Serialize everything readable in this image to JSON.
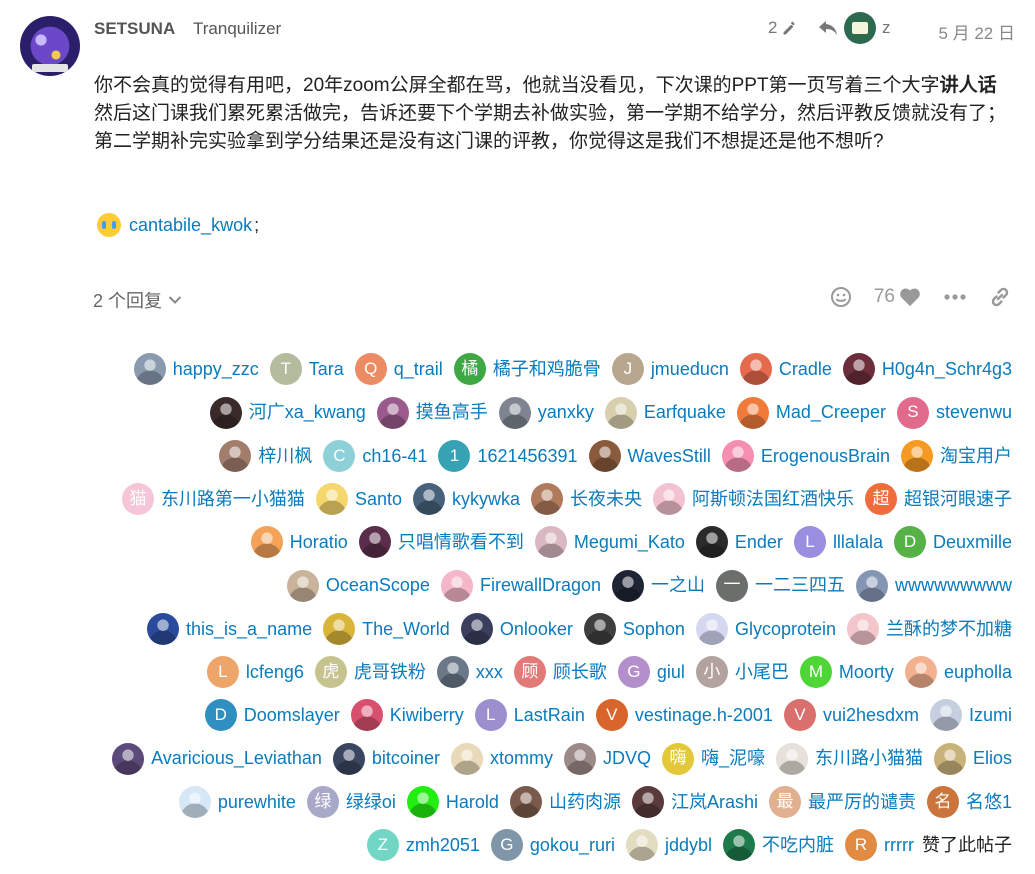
{
  "post": {
    "username": "SETSUNA",
    "full_name": "Tranquilizer",
    "edit_count": "2",
    "reply_to": "z",
    "date": "5 月 22 日",
    "body_p1_normal": "你不会真的觉得有用吧，20年zoom公屏全都在骂，他就当没看见，下次课的PPT第一页写着三个大字",
    "body_p1_bold": "讲人话",
    "body_p2": "然后这门课我们累死累活做完，告诉还要下个学期去补做实验，第一学期不给学分，然后评教反馈就没有了；第二学期补完实验拿到学分结果还是没有这门课的评教，你觉得这是我们不想提还是他不想听?",
    "mention": "cantabile_kwok",
    "mention_suffix": ";",
    "replies_label": "2 个回复",
    "like_count": "76",
    "likers_suffix": "赞了此帖子"
  },
  "likers": [
    {
      "name": "happy_zzc",
      "letter": "",
      "color": "#8a9bb0"
    },
    {
      "name": "Tara",
      "letter": "T",
      "color": "#b3bc9d"
    },
    {
      "name": "q_trail",
      "letter": "Q",
      "color": "#ec8c64"
    },
    {
      "name": "橘子和鸡脆骨",
      "letter": "橘",
      "color": "#3ea845"
    },
    {
      "name": "jmueducn",
      "letter": "J",
      "color": "#b8a78f"
    },
    {
      "name": "Cradle",
      "letter": "",
      "color": "#e56a4e"
    },
    {
      "name": "H0g4n_Schr4g3",
      "letter": "",
      "color": "#6b2e3a"
    },
    {
      "name": "河广xa_kwang",
      "letter": "",
      "color": "#3b2a2a"
    },
    {
      "name": "摸鱼高手",
      "letter": "",
      "color": "#9a5a8c"
    },
    {
      "name": "yanxky",
      "letter": "",
      "color": "#7e8590"
    },
    {
      "name": "Earfquake",
      "letter": "",
      "color": "#d8cfae"
    },
    {
      "name": "Mad_Creeper",
      "letter": "",
      "color": "#f07a3a"
    },
    {
      "name": "stevenwu",
      "letter": "S",
      "color": "#e26a8c"
    },
    {
      "name": "梓川枫",
      "letter": "",
      "color": "#a27d6c"
    },
    {
      "name": "ch16-41",
      "letter": "C",
      "color": "#8ed0d8"
    },
    {
      "name": "1621456391",
      "letter": "1",
      "color": "#38a2b5"
    },
    {
      "name": "WavesStill",
      "letter": "",
      "color": "#8a5a3c"
    },
    {
      "name": "ErogenousBrain",
      "letter": "",
      "color": "#f48fb1"
    },
    {
      "name": "淘宝用户",
      "letter": "",
      "color": "#f59a22"
    },
    {
      "name": "东川路第一小猫猫",
      "letter": "猫",
      "color": "#f6c6d8"
    },
    {
      "name": "Santo",
      "letter": "",
      "color": "#f5d76e"
    },
    {
      "name": "kykywka",
      "letter": "",
      "color": "#47617a"
    },
    {
      "name": "长夜未央",
      "letter": "",
      "color": "#b07a5c"
    },
    {
      "name": "阿斯顿法国红酒快乐",
      "letter": "",
      "color": "#f3c2d0"
    },
    {
      "name": "超银河眼速子",
      "letter": "超",
      "color": "#ef6d3d"
    },
    {
      "name": "Horatio",
      "letter": "",
      "color": "#f4a25a"
    },
    {
      "name": "只唱情歌看不到",
      "letter": "",
      "color": "#5a2d4a"
    },
    {
      "name": "Megumi_Kato",
      "letter": "",
      "color": "#d9b8c2"
    },
    {
      "name": "Ender",
      "letter": "",
      "color": "#2b2b2b"
    },
    {
      "name": "lllalala",
      "letter": "L",
      "color": "#9a8ee0"
    },
    {
      "name": "Deuxmille",
      "letter": "D",
      "color": "#56b146"
    },
    {
      "name": "OceanScope",
      "letter": "",
      "color": "#c9b39a"
    },
    {
      "name": "FirewallDragon",
      "letter": "",
      "color": "#f4b6c8"
    },
    {
      "name": "一之山",
      "letter": "",
      "color": "#1e2433"
    },
    {
      "name": "一二三四五",
      "letter": "一",
      "color": "#6b6f6b"
    },
    {
      "name": "wwwwwwwww",
      "letter": "",
      "color": "#8596b5"
    },
    {
      "name": "this_is_a_name",
      "letter": "",
      "color": "#2a4b9b"
    },
    {
      "name": "The_World",
      "letter": "",
      "color": "#d9b53a"
    },
    {
      "name": "Onlooker",
      "letter": "",
      "color": "#3a3f5e"
    },
    {
      "name": "Sophon",
      "letter": "",
      "color": "#3f3f3f"
    },
    {
      "name": "Glycoprotein",
      "letter": "",
      "color": "#d6d8f2"
    },
    {
      "name": "兰酥的梦不加糖",
      "letter": "",
      "color": "#f3c6cc"
    },
    {
      "name": "lcfeng6",
      "letter": "L",
      "color": "#eea56a"
    },
    {
      "name": "虎哥铁粉",
      "letter": "虎",
      "color": "#c6c38e"
    },
    {
      "name": "xxx",
      "letter": "",
      "color": "#6a7888"
    },
    {
      "name": "顾长歌",
      "letter": "顾",
      "color": "#e27a78"
    },
    {
      "name": "giul",
      "letter": "G",
      "color": "#b38fcc"
    },
    {
      "name": "小尾巴",
      "letter": "小",
      "color": "#b4a29f"
    },
    {
      "name": "Moorty",
      "letter": "M",
      "color": "#4dd636"
    },
    {
      "name": "eupholla",
      "letter": "",
      "color": "#f2b08f"
    },
    {
      "name": "Doomslayer",
      "letter": "D",
      "color": "#2f8fc0"
    },
    {
      "name": "Kiwiberry",
      "letter": "",
      "color": "#d8506e"
    },
    {
      "name": "LastRain",
      "letter": "L",
      "color": "#9c8fce"
    },
    {
      "name": "vestinage.h-2001",
      "letter": "V",
      "color": "#d9652c"
    },
    {
      "name": "vui2hesdxm",
      "letter": "V",
      "color": "#d9706e"
    },
    {
      "name": "Izumi",
      "letter": "",
      "color": "#c5cfe0"
    },
    {
      "name": "Avaricious_Leviathan",
      "letter": "",
      "color": "#5c4a7a"
    },
    {
      "name": "bitcoiner",
      "letter": "",
      "color": "#3a4560"
    },
    {
      "name": "xtommy",
      "letter": "",
      "color": "#e9d9b8"
    },
    {
      "name": "JDVQ",
      "letter": "",
      "color": "#9c8a88"
    },
    {
      "name": "嗨_泥嚎",
      "letter": "嗨",
      "color": "#e3c93a"
    },
    {
      "name": "东川路小猫猫",
      "letter": "",
      "color": "#e8e0da"
    },
    {
      "name": "Elios",
      "letter": "",
      "color": "#c9b27a"
    },
    {
      "name": "purewhite",
      "letter": "",
      "color": "#d6e8f8"
    },
    {
      "name": "绿绿oi",
      "letter": "绿",
      "color": "#a8a8c8"
    },
    {
      "name": "Harold",
      "letter": "",
      "color": "#22ee11"
    },
    {
      "name": "山药肉源",
      "letter": "",
      "color": "#7a5a4a"
    },
    {
      "name": "江岚Arashi",
      "letter": "",
      "color": "#5a3a3a"
    },
    {
      "name": "最严厉的谴责",
      "letter": "最",
      "color": "#e0b090"
    },
    {
      "name": "名悠1",
      "letter": "名",
      "color": "#c9753c"
    },
    {
      "name": "zmh2051",
      "letter": "Z",
      "color": "#72d6c4"
    },
    {
      "name": "gokou_ruri",
      "letter": "G",
      "color": "#7f96a8"
    },
    {
      "name": "jddybl",
      "letter": "",
      "color": "#e2dcc0"
    },
    {
      "name": "不吃内脏",
      "letter": "",
      "color": "#1e7a4a"
    },
    {
      "name": "rrrrr",
      "letter": "R",
      "color": "#e08a42"
    }
  ]
}
